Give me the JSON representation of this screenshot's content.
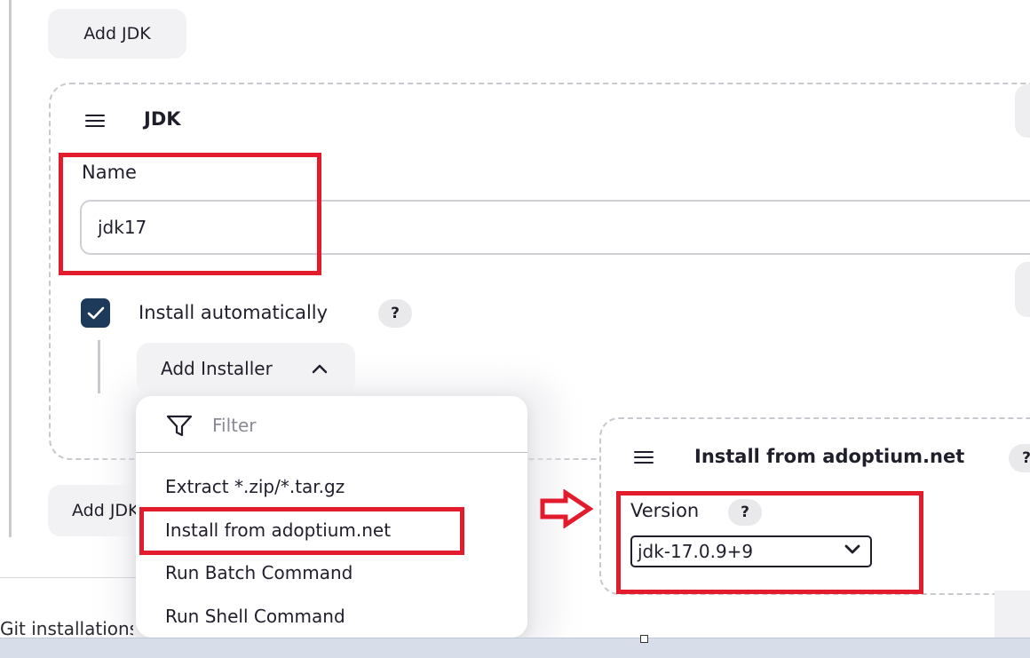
{
  "jdk_section": {
    "add_jdk_top_label": "Add JDK",
    "add_jdk_bottom_label": "Add JDK",
    "card_title": "JDK",
    "name_label": "Name",
    "name_value": "jdk17",
    "install_auto_label": "Install automatically",
    "install_auto_checked": true,
    "help_glyph": "?",
    "add_installer_label": "Add Installer"
  },
  "installer_dropdown": {
    "filter_placeholder": "Filter",
    "items": [
      "Extract *.zip/*.tar.gz",
      "Install from adoptium.net",
      "Run Batch Command",
      "Run Shell Command"
    ],
    "highlighted_item": "Install from adoptium.net"
  },
  "adoptium_section": {
    "title": "Install from adoptium.net",
    "version_label": "Version",
    "version_value": "jdk-17.0.9+9"
  },
  "background": {
    "cut_off_text": "Git installations"
  },
  "colors": {
    "annotation_red": "#e21b2d",
    "checkbox_fill": "#1d3a5a",
    "button_bg": "#f2f2f4",
    "dashed_border": "#c8c8ce"
  },
  "icons": [
    "hamburger-icon",
    "check-icon",
    "chevron-up-icon",
    "filter-icon",
    "chevron-down-icon",
    "right-arrow-icon"
  ]
}
